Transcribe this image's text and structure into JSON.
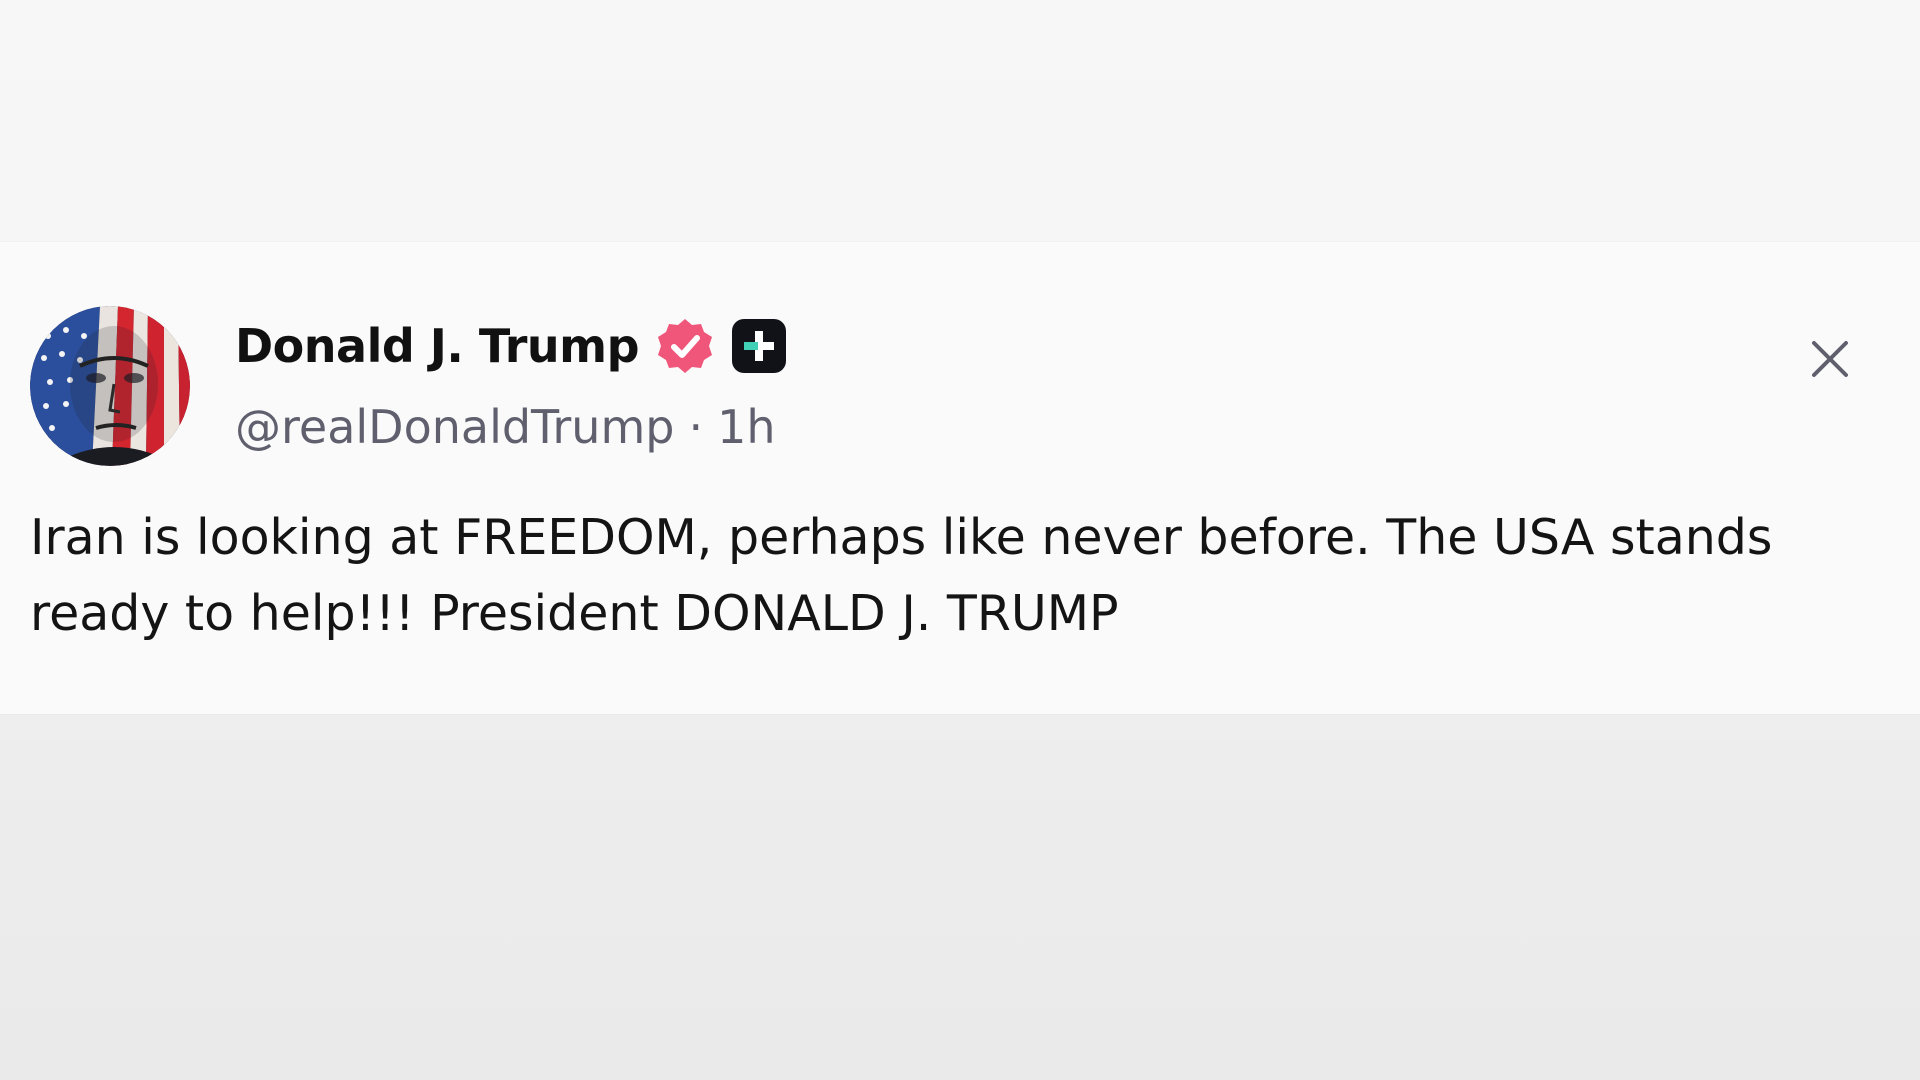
{
  "post": {
    "author": {
      "display_name": "Donald J. Trump",
      "handle": "@realDonaldTrump",
      "avatar_icon": "flag-portrait-avatar",
      "verified_icon": "verified-badge-icon",
      "plus_icon": "plus-badge-icon"
    },
    "separator": "·",
    "time_ago": "1h",
    "text": "Iran is looking at FREEDOM, perhaps like never before. The USA stands ready to help!!! President DONALD J. TRUMP",
    "close_icon": "close-icon"
  },
  "colors": {
    "verified_badge": "#f0567a",
    "plus_badge_bg": "#111118",
    "plus_badge_accent": "#3fd0b6",
    "text_primary": "#111111",
    "text_secondary": "#5f5f6e"
  }
}
